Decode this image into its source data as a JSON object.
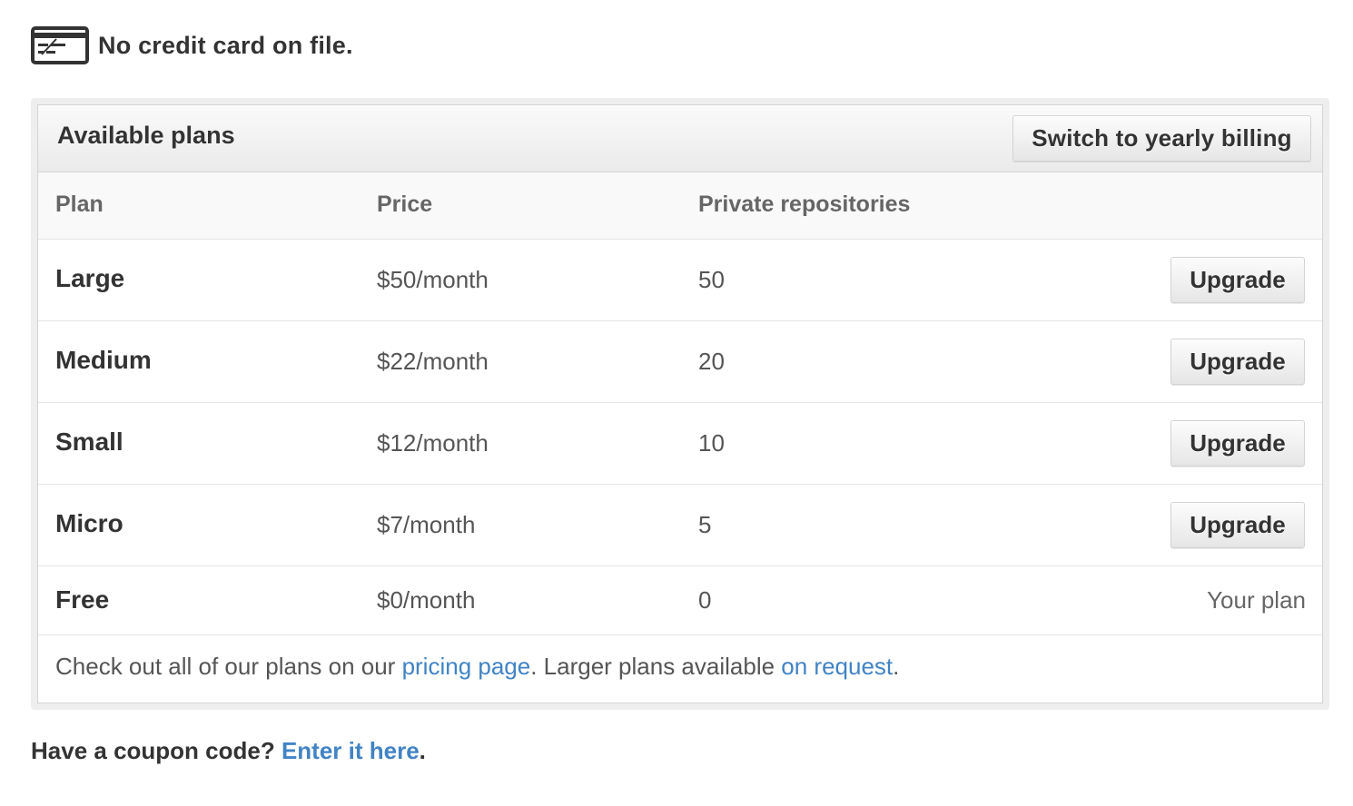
{
  "card_status": {
    "icon": "credit-card-icon",
    "text": "No credit card on file."
  },
  "plans_box": {
    "title": "Available plans",
    "switch_billing_label": "Switch to yearly billing",
    "columns": {
      "plan": "Plan",
      "price": "Price",
      "private_repos": "Private repositories"
    },
    "rows": [
      {
        "name": "Large",
        "price": "$50/month",
        "repos": "50",
        "action": "Upgrade"
      },
      {
        "name": "Medium",
        "price": "$22/month",
        "repos": "20",
        "action": "Upgrade"
      },
      {
        "name": "Small",
        "price": "$12/month",
        "repos": "10",
        "action": "Upgrade"
      },
      {
        "name": "Micro",
        "price": "$7/month",
        "repos": "5",
        "action": "Upgrade"
      },
      {
        "name": "Free",
        "price": "$0/month",
        "repos": "0",
        "current_label": "Your plan"
      }
    ],
    "footer": {
      "prefix": "Check out all of our plans on our ",
      "pricing_link": "pricing page",
      "middle": ". Larger plans available ",
      "request_link": "on request",
      "suffix": "."
    }
  },
  "coupon": {
    "question": "Have a coupon code? ",
    "link": "Enter it here",
    "suffix": "."
  },
  "colors": {
    "link": "#4183c4",
    "text": "#333333",
    "muted": "#666666"
  }
}
